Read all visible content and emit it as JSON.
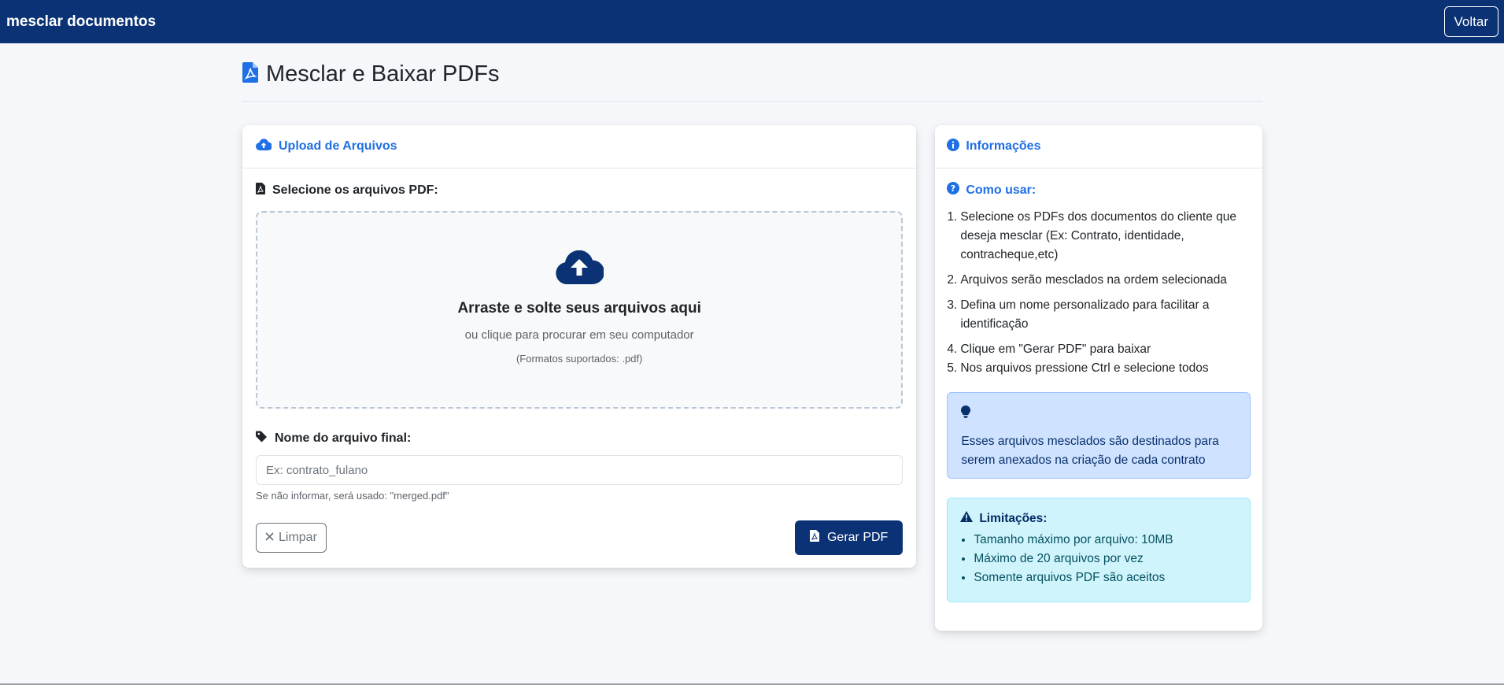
{
  "navbar": {
    "brand": "mesclar documentos",
    "back_label": "Voltar"
  },
  "page": {
    "title": "Mesclar e Baixar PDFs"
  },
  "upload_card": {
    "header": "Upload de Arquivos",
    "select_label": "Selecione os arquivos PDF:",
    "dropzone": {
      "title": "Arraste e solte seus arquivos aqui",
      "subtitle": "ou clique para procurar em seu computador",
      "formats": "(Formatos suportados: .pdf)"
    },
    "name_label": "Nome do arquivo final:",
    "name_input": {
      "value": "",
      "placeholder": "Ex: contrato_fulano"
    },
    "help_text": "Se não informar, será usado: \"merged.pdf\"",
    "clear_label": "Limpar",
    "generate_label": "Gerar PDF"
  },
  "info_card": {
    "header": "Informações",
    "howto_title": "Como usar:",
    "steps": [
      "Selecione os PDFs dos documentos do cliente que deseja mesclar (Ex: Contrato, identidade, contracheque,etc)",
      "Arquivos serão mesclados na ordem selecionada",
      "Defina um nome personalizado para facilitar a identificação",
      "Clique em \"Gerar PDF\" para baixar",
      "Nos arquivos pressione Ctrl e selecione todos"
    ],
    "tip_text": "Esses arquivos mesclados são destinados para serem anexados na criação de cada contrato",
    "limits_title": "Limitações:",
    "limits": [
      "Tamanho máximo por arquivo: 10MB",
      "Máximo de 20 arquivos por vez",
      "Somente arquivos PDF são aceitos"
    ]
  },
  "colors": {
    "navbar": "#0b3275",
    "accent": "#1f6fe5",
    "primary_button": "#0b3275"
  }
}
